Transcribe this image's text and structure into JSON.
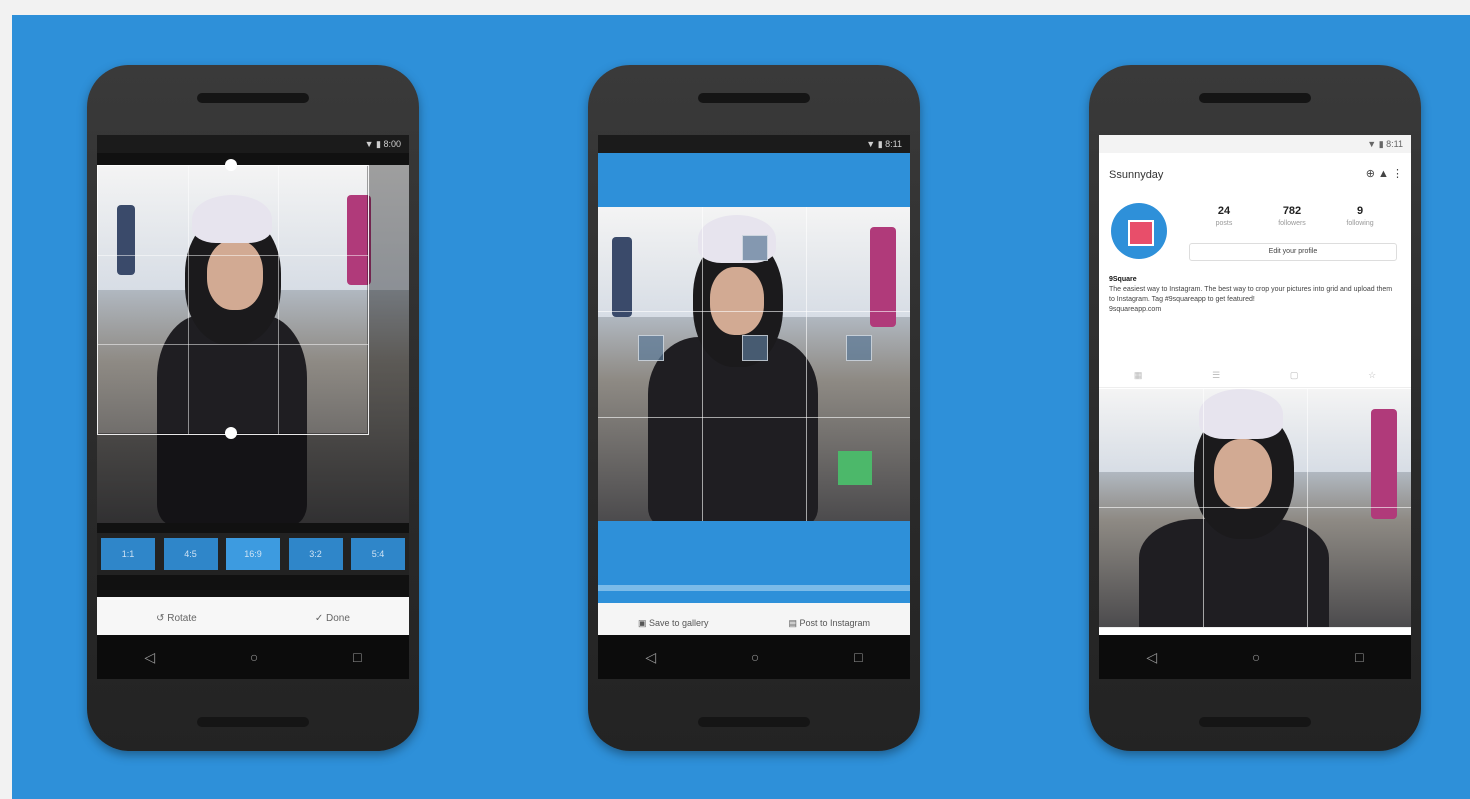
{
  "colors": {
    "background": "#2e90d9",
    "phone_body": "#2f2f2f",
    "accent": "#3d9be0",
    "green": "#4cb86a"
  },
  "phone1": {
    "status_text": "▼ ▮ 8:00",
    "ratio_buttons": [
      "1:1",
      "4:5",
      "16:9",
      "3:2",
      "5:4"
    ],
    "actions": {
      "left_icon": "↺",
      "left_label": "Rotate",
      "right_icon": "✓",
      "right_label": "Done"
    },
    "nav": {
      "back": "◁",
      "home": "○",
      "recent": "□"
    }
  },
  "phone2": {
    "status_text": "▼ ▮ 8:11",
    "actions": {
      "left_icon": "▣",
      "left_label": "Save to gallery",
      "right_icon": "▤",
      "right_label": "Post to Instagram"
    },
    "nav": {
      "back": "◁",
      "home": "○",
      "recent": "□"
    }
  },
  "phone3": {
    "status_text": "▼ ▮ 8:11",
    "title": "Ssunnyday",
    "top_icons": "⊕ ▲ ⋮",
    "stats": [
      {
        "value": "24",
        "label": "posts"
      },
      {
        "value": "782",
        "label": "followers"
      },
      {
        "value": "9",
        "label": "following"
      }
    ],
    "edit_label": "Edit your profile",
    "bio_name": "9Square",
    "bio_text": "The easiest way to Instagram. The best way to crop your pictures into grid and upload them to Instagram. Tag #9squareapp to get featured!",
    "bio_link": "9squareapp.com",
    "tab_icons": [
      "▦",
      "☰",
      "▢",
      "☆"
    ],
    "bottom_nav": [
      "⌂",
      "⌕",
      "⊕",
      "♡",
      "☺"
    ],
    "nav": {
      "back": "◁",
      "home": "○",
      "recent": "□"
    }
  }
}
